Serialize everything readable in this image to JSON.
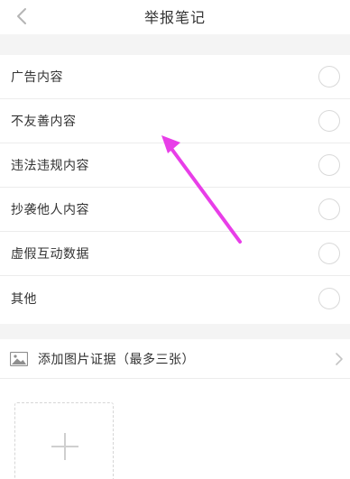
{
  "header": {
    "title": "举报笔记",
    "back_icon": "chevron-left-icon"
  },
  "options": [
    {
      "label": "广告内容",
      "selected": false
    },
    {
      "label": "不友善内容",
      "selected": false
    },
    {
      "label": "违法违规内容",
      "selected": false
    },
    {
      "label": "抄袭他人内容",
      "selected": false
    },
    {
      "label": "虚假互动数据",
      "selected": false
    },
    {
      "label": "其他",
      "selected": false
    }
  ],
  "evidence": {
    "label": "添加图片证据（最多三张）",
    "icon": "image-icon"
  },
  "upload": {
    "icon": "plus-icon"
  },
  "colors": {
    "annotation_arrow": "#e83ee8",
    "background": "#f4f4f4",
    "text": "#333333"
  }
}
